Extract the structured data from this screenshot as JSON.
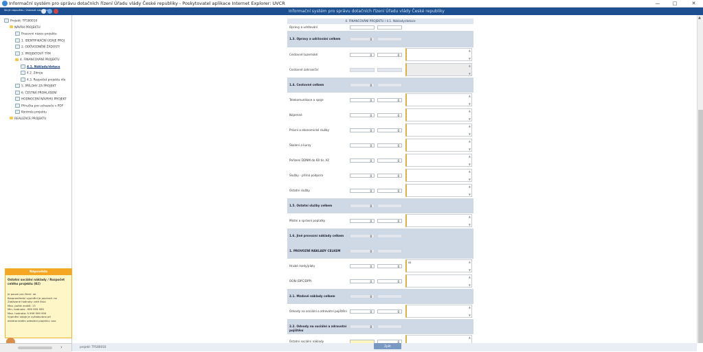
{
  "window": {
    "title": "Informační systém pro správu dotačních řízení Úřadu vlády České republiky - Poskytovatel aplikace Internet Explorer: UVCR",
    "min": "—",
    "max": "□",
    "close": "✕"
  },
  "toolbar": {
    "button_label": "Skrýt nápovědu / Zobrazit nápovědu",
    "app_title": "Informační systém pro správu dotačních řízení Úřadu vlády České republiky",
    "icons": [
      "back-icon",
      "info-icon",
      "close-icon"
    ]
  },
  "sidebar": {
    "items": [
      {
        "label": "Projekt: TP180010",
        "indent": 0,
        "icon": "page"
      },
      {
        "label": "NÁVRH PROJEKTU",
        "indent": 1,
        "icon": "folder"
      },
      {
        "label": "Pracovní název projektu",
        "indent": 2,
        "icon": "page"
      },
      {
        "label": "1. IDENTIFIKAČNÍ ÚDAJE PROJ",
        "indent": 2,
        "icon": "page"
      },
      {
        "label": "2. ODŮVODNĚNÍ ŽÁDOSTI",
        "indent": 2,
        "icon": "page"
      },
      {
        "label": "3. PROJEKTOVÝ TÝM",
        "indent": 2,
        "icon": "page"
      },
      {
        "label": "4. FINANCOVÁNÍ PROJEKTU",
        "indent": 2,
        "icon": "folder"
      },
      {
        "label": "4.1. Náklady/dotace",
        "indent": 3,
        "icon": "page",
        "active": true
      },
      {
        "label": "4.2. Zdroje",
        "indent": 3,
        "icon": "page"
      },
      {
        "label": "4.3. Rozpočet projektu dle",
        "indent": 3,
        "icon": "page"
      },
      {
        "label": "5. PŘÍLOHY ZA PROJEKT",
        "indent": 2,
        "icon": "page"
      },
      {
        "label": "6. ČESTNÁ PROHLÁŠENÍ",
        "indent": 2,
        "icon": "page"
      },
      {
        "label": "HODNOCENÍ NÁVRHU PROJEKT",
        "indent": 2,
        "icon": "page"
      },
      {
        "label": "Příručka pro uchazeče v PDF",
        "indent": 2,
        "icon": "page"
      },
      {
        "label": "Kontrola projektu",
        "indent": 2,
        "icon": "page"
      },
      {
        "label": "REALIZACE PROJEKTU",
        "indent": 1,
        "icon": "folder"
      }
    ]
  },
  "help": {
    "header": "Nápověda",
    "title": "Ostatní sociální náklady / Rozpočet celého projektu (Kč)",
    "text": "Je pouze pro čtení: ne\nBezprostřední vyplnění je povinné: ne\nZadávané hodnoty: celé číslo\nMax. počet znaků: 13\nMin. hodnota: -999 999 999\nMax. hodnota: 9 999 999 999\nVyplnění údaje je vyžadováno při elektronickém odeslání projektu: ano"
  },
  "footer": {
    "status": "projekt: TP180010",
    "back_button": "Zpět"
  },
  "form": {
    "section_header": "4. FINANCOVÁNÍ PROJEKTU / 4.1. Náklady/dotace",
    "rows": [
      {
        "label": "Opravy a udržování",
        "type": "partial",
        "v1": "",
        "v2": "",
        "note": false
      },
      {
        "label": "1.3. Opravy a udržování celkem",
        "type": "group",
        "v1": "0",
        "v2": "",
        "note": false
      },
      {
        "label": "Cestovné tuzemské",
        "type": "item",
        "v1": "0",
        "v2": "0",
        "note": true
      },
      {
        "label": "Cestovné zahraniční",
        "type": "item-dis",
        "v1": "",
        "v2": "",
        "note": true
      },
      {
        "label": "1.4. Cestovné celkem",
        "type": "group",
        "v1": "0",
        "v2": "",
        "note": false
      },
      {
        "label": "Telekomunikace a spoje",
        "type": "item",
        "v1": "0",
        "v2": "0",
        "note": true
      },
      {
        "label": "Nájemné",
        "type": "item",
        "v1": "0",
        "v2": "0",
        "note": true
      },
      {
        "label": "Právní a ekonomické služby",
        "type": "item",
        "v1": "0",
        "v2": "0",
        "note": true
      },
      {
        "label": "Školení a kurzy",
        "type": "item",
        "v1": "0",
        "v2": "0",
        "note": true
      },
      {
        "label": "Pořízení DDNM do 60 tis. Kč",
        "type": "item",
        "v1": "0",
        "v2": "0",
        "note": true
      },
      {
        "label": "Služby - přímá podpora",
        "type": "item",
        "v1": "0",
        "v2": "0",
        "note": true
      },
      {
        "label": "Ostatní služby",
        "type": "item",
        "v1": "0",
        "v2": "0",
        "note": true
      },
      {
        "label": "1.5. Ostatní služby celkem",
        "type": "group",
        "v1": "0",
        "v2": "",
        "note": false
      },
      {
        "label": "Místní a správní poplatky",
        "type": "item",
        "v1": "0",
        "v2": "0",
        "note": true
      },
      {
        "label": "1.6. Jiné provozní náklady celkem",
        "type": "group",
        "v1": "0",
        "v2": "",
        "note": false
      },
      {
        "label": "1. PROVOZNÍ NÁKLADY CELKEM",
        "type": "group",
        "v1": "0",
        "v2": "",
        "note": false
      },
      {
        "label": "Hrubé mzdy/platy",
        "type": "item",
        "v1": "0",
        "v2": "0",
        "note": true,
        "note_text": "ss"
      },
      {
        "label": "OON (DPČ/DPP)",
        "type": "item",
        "v1": "0",
        "v2": "0",
        "note": true
      },
      {
        "label": "2.1. Mzdové náklady celkem",
        "type": "group",
        "v1": "0",
        "v2": "",
        "note": false
      },
      {
        "label": "Odvody na sociální a zdravotní pojištění",
        "type": "item",
        "v1": "0",
        "v2": "0",
        "note": true
      },
      {
        "label": "2.2. Odvody na sociální a zdravotní pojištění",
        "type": "group",
        "v1": "0",
        "v2": "",
        "note": false
      },
      {
        "label": "Ostatní sociální náklady",
        "type": "item-hl",
        "v1": "",
        "v2": "0",
        "note": true
      }
    ]
  }
}
